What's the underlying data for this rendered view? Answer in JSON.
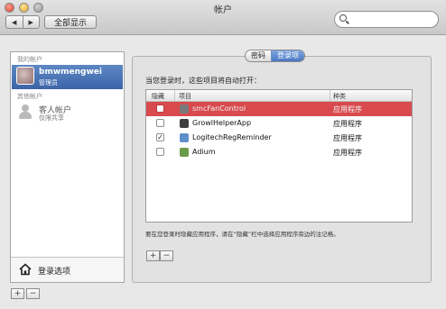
{
  "window": {
    "title": "帐户",
    "nav_back": "◀",
    "nav_forward": "▶",
    "show_all": "全部显示",
    "search": {
      "placeholder": "",
      "value": ""
    }
  },
  "sidebar": {
    "my_accounts_header": "我的帐户",
    "current_account": {
      "name": "bmwmengwei",
      "role": "管理员"
    },
    "other_accounts_header": "其他帐户",
    "guest_account": {
      "name": "客人帐户",
      "sub": "仅限共享"
    },
    "login_options": "登录选项",
    "add_button": "+",
    "remove_button": "−"
  },
  "tabs": [
    {
      "label": "密码",
      "active": false
    },
    {
      "label": "登录项",
      "active": true
    }
  ],
  "login_items": {
    "prompt": "当您登录时，这些项目将自动打开：",
    "columns": {
      "hide": "隐藏",
      "item": "项目",
      "kind": "种类"
    },
    "rows": [
      {
        "hidden": false,
        "name": "smcFanControl",
        "kind": "应用程序",
        "selected": true,
        "icon_color": "#7a7a7a"
      },
      {
        "hidden": false,
        "name": "GrowlHelperApp",
        "kind": "应用程序",
        "selected": false,
        "icon_color": "#3d3d3d"
      },
      {
        "hidden": true,
        "name": "LogitechRegReminder",
        "kind": "应用程序",
        "selected": false,
        "icon_color": "#5f8fc9"
      },
      {
        "hidden": false,
        "name": "Adium",
        "kind": "应用程序",
        "selected": false,
        "icon_color": "#6c9b4a"
      }
    ],
    "checked_mark": "✓",
    "hint": "要在您登录时隐藏应用程序，请在“隐藏”栏中选择应用程序旁边的注记格。",
    "add_button": "+",
    "remove_button": "−"
  }
}
